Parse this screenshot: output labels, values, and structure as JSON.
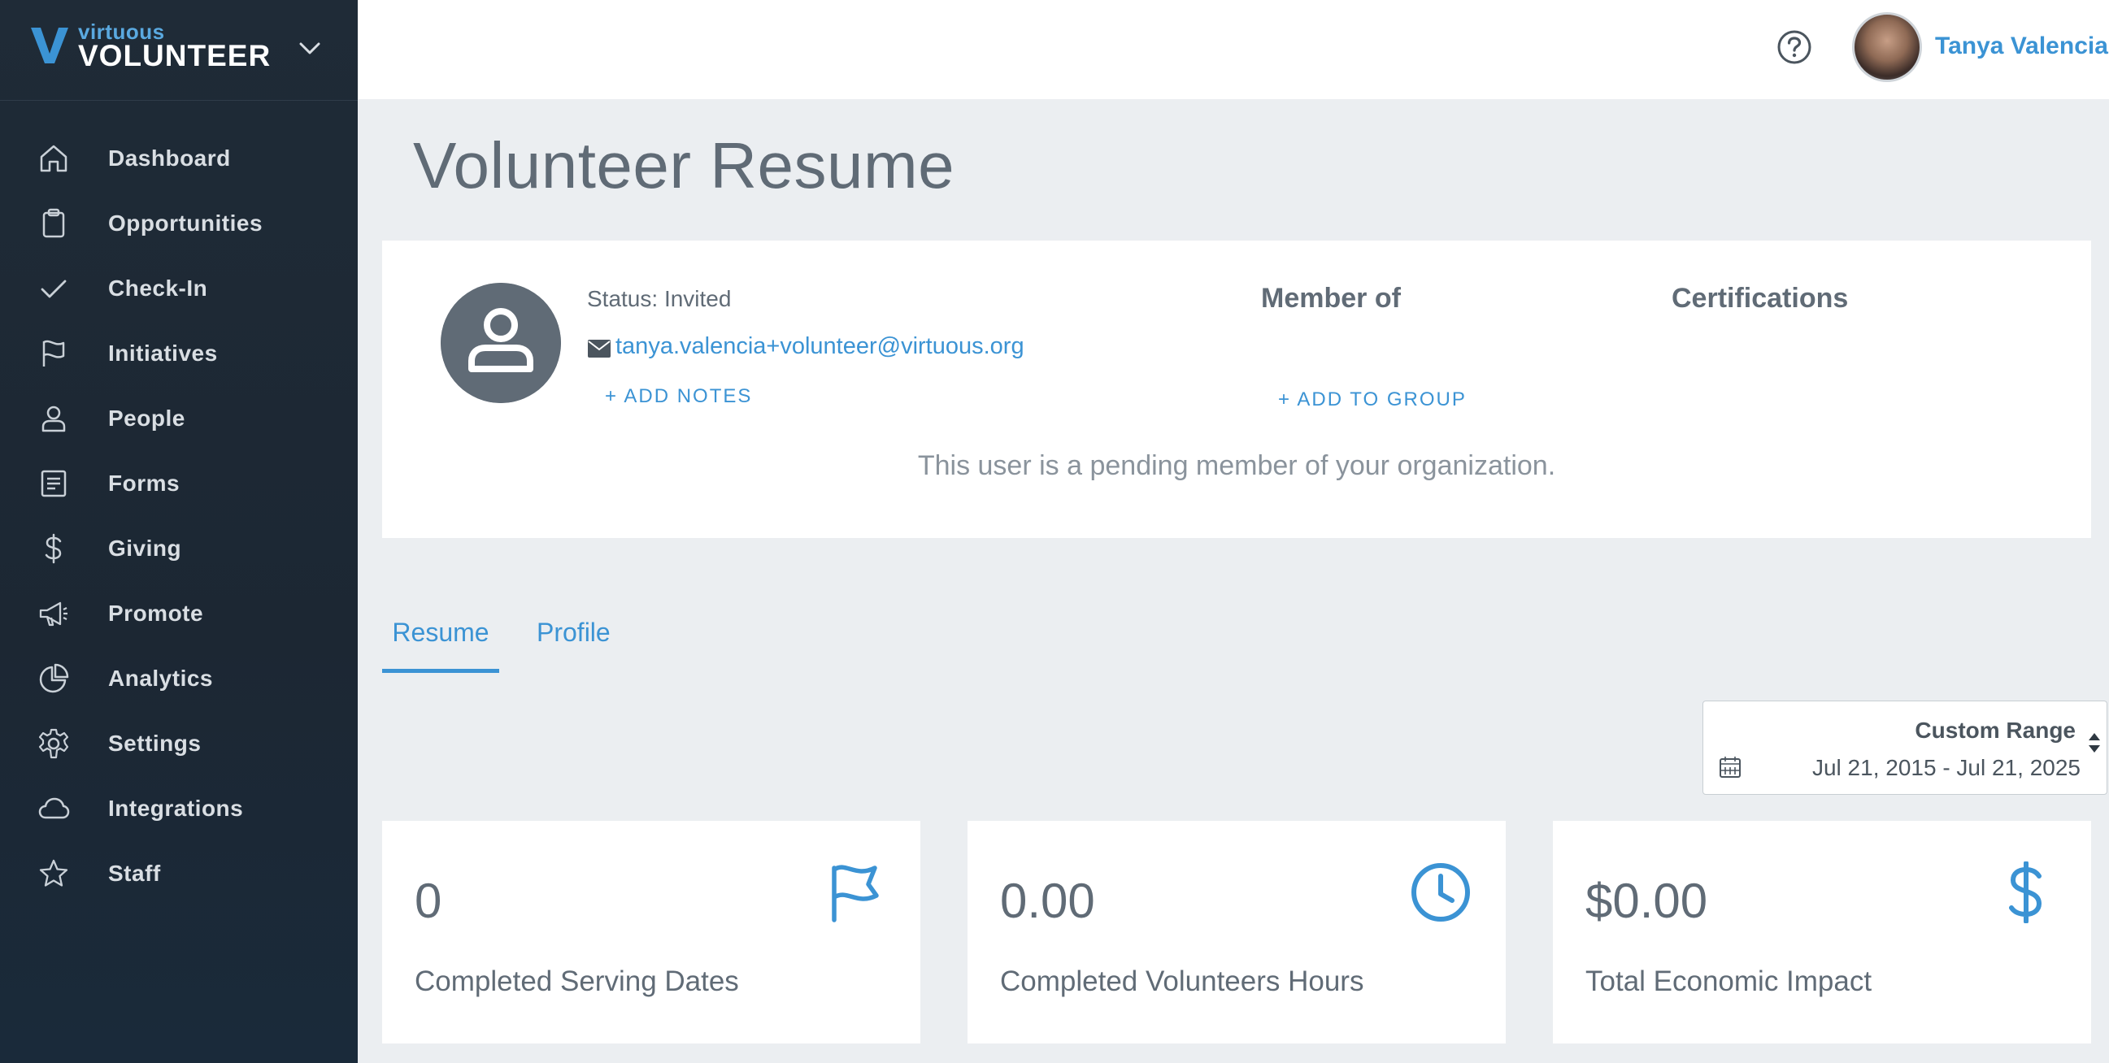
{
  "brand": {
    "small": "virtuous",
    "big": "VOLUNTEER"
  },
  "sidebar": {
    "items": [
      {
        "label": "Dashboard",
        "icon": "home-icon"
      },
      {
        "label": "Opportunities",
        "icon": "clipboard-icon"
      },
      {
        "label": "Check-In",
        "icon": "check-icon"
      },
      {
        "label": "Initiatives",
        "icon": "flag-icon"
      },
      {
        "label": "People",
        "icon": "person-icon"
      },
      {
        "label": "Forms",
        "icon": "form-icon"
      },
      {
        "label": "Giving",
        "icon": "dollar-icon"
      },
      {
        "label": "Promote",
        "icon": "megaphone-icon"
      },
      {
        "label": "Analytics",
        "icon": "pie-chart-icon"
      },
      {
        "label": "Settings",
        "icon": "gear-icon"
      },
      {
        "label": "Integrations",
        "icon": "cloud-icon"
      },
      {
        "label": "Staff",
        "icon": "star-icon"
      }
    ]
  },
  "header": {
    "user_name": "Tanya Valencia"
  },
  "page": {
    "title": "Volunteer Resume"
  },
  "profile": {
    "status": "Status: Invited",
    "email": "tanya.valencia+volunteer@virtuous.org",
    "add_notes": "+ ADD NOTES",
    "member_of": "Member of",
    "add_to_group": "+ ADD TO GROUP",
    "certifications": "Certifications",
    "pending_message": "This user is a pending member of your organization."
  },
  "tabs": [
    {
      "label": "Resume",
      "active": true
    },
    {
      "label": "Profile",
      "active": false
    }
  ],
  "date_range": {
    "title": "Custom Range",
    "value": "Jul 21, 2015 - Jul 21, 2025"
  },
  "stats": [
    {
      "value": "0",
      "label": "Completed Serving Dates",
      "icon": "flag-icon"
    },
    {
      "value": "0.00",
      "label": "Completed Volunteers Hours",
      "icon": "clock-icon"
    },
    {
      "value": "$0.00",
      "label": "Total Economic Impact",
      "icon": "dollar-icon"
    }
  ],
  "colors": {
    "accent": "#3b93d4",
    "sidebar": "#1f2b37",
    "text": "#606b76",
    "background": "#ebeef1"
  }
}
